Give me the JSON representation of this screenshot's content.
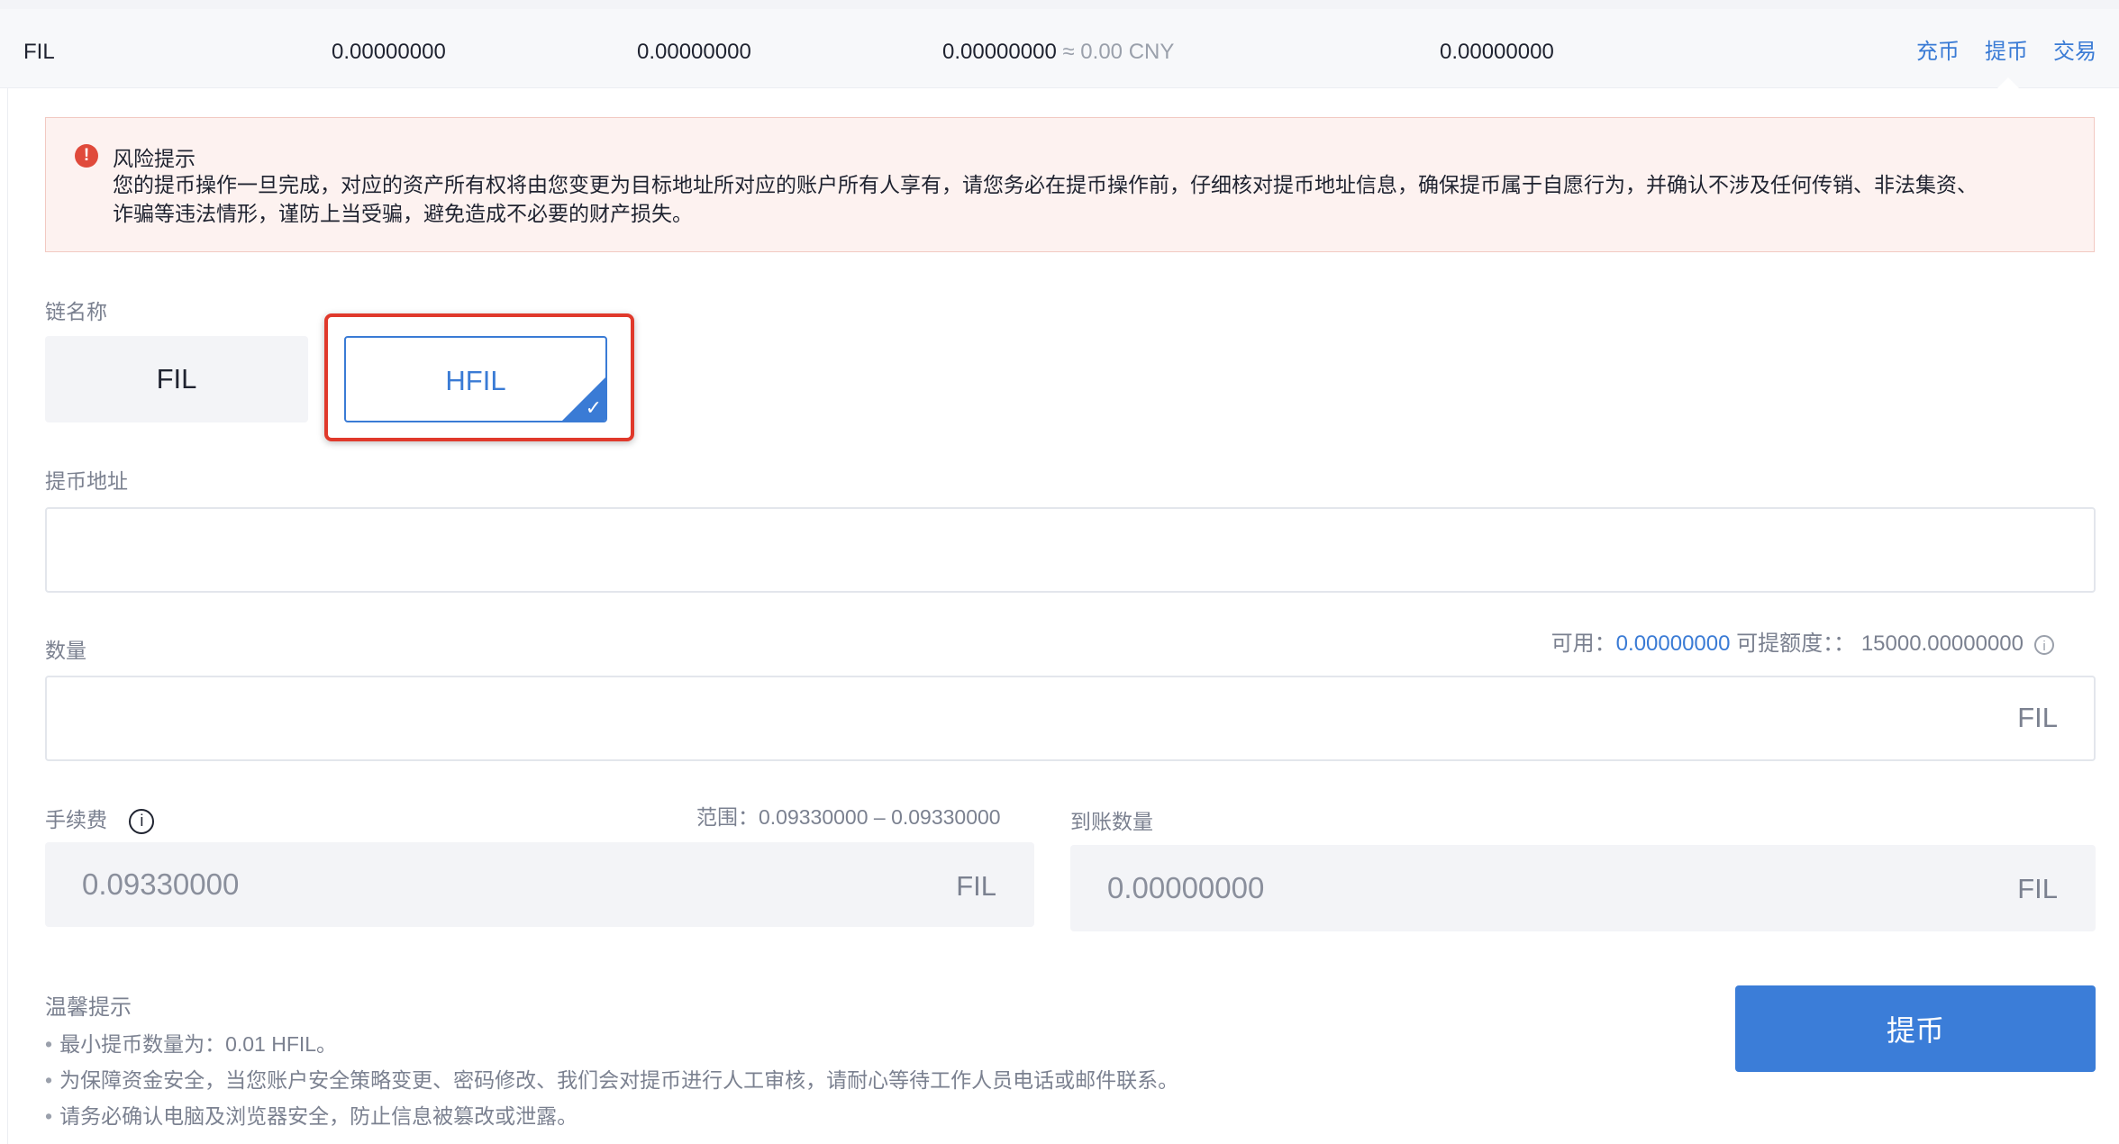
{
  "asset_row": {
    "coin": "FIL",
    "col1": "0.00000000",
    "col2": "0.00000000",
    "col3": "0.00000000",
    "col3_cny": "≈ 0.00 CNY",
    "col4": "0.00000000",
    "actions": {
      "deposit": "充币",
      "withdraw": "提币",
      "trade": "交易"
    }
  },
  "risk": {
    "icon": "exclamation-circle-icon",
    "title": "风险提示",
    "line1": "您的提币操作一旦完成，对应的资产所有权将由您变更为目标地址所对应的账户所有人享有，请您务必在提币操作前，仔细核对提币地址信息，确保提币属于自愿行为，并确认不涉及任何传销、非法集资、",
    "line2": "诈骗等违法情形，谨防上当受骗，避免造成不必要的财产损失。"
  },
  "chain": {
    "label": "链名称",
    "options": [
      "FIL",
      "HFIL"
    ],
    "selected": "HFIL"
  },
  "address": {
    "label": "提币地址",
    "value": ""
  },
  "amount": {
    "label": "数量",
    "available_label": "可用：",
    "available_value": "0.00000000",
    "limit_label": "可提额度：：",
    "limit_value": "15000.00000000",
    "unit": "FIL",
    "value": ""
  },
  "fee": {
    "label": "手续费",
    "range_label": "范围：",
    "range_value": "0.09330000 – 0.09330000",
    "value": "0.09330000",
    "unit": "FIL"
  },
  "received": {
    "label": "到账数量",
    "value": "0.00000000",
    "unit": "FIL"
  },
  "tips": {
    "title": "温馨提示",
    "items": [
      "最小提币数量为：0.01 HFIL。",
      "为保障资金安全，当您账户安全策略变更、密码修改、我们会对提币进行人工审核，请耐心等待工作人员电话或邮件联系。",
      "请务必确认电脑及浏览器安全，防止信息被篡改或泄露。"
    ]
  },
  "submit_label": "提币",
  "colors": {
    "accent": "#3a7bd5",
    "danger": "#e04a3b",
    "risk_bg": "#fdf2f0"
  }
}
